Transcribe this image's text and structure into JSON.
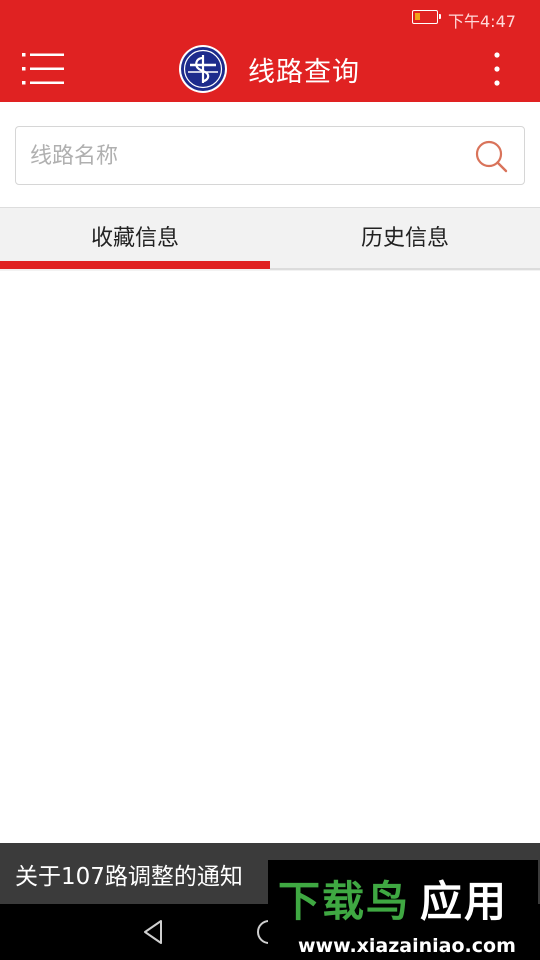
{
  "status_bar": {
    "time": "下午4:47",
    "battery_icon": "battery-low-icon"
  },
  "app_bar": {
    "title": "线路查询",
    "menu_icon": "menu-list-icon",
    "logo_icon": "transit-logo-icon",
    "more_icon": "more-vertical-icon",
    "color": "#e02222"
  },
  "search": {
    "placeholder": "线路名称",
    "value": "",
    "icon": "search-icon",
    "icon_color": "#d9735a"
  },
  "tabs": [
    {
      "label": "收藏信息",
      "selected": true
    },
    {
      "label": "历史信息",
      "selected": false
    }
  ],
  "notice": {
    "text": "关于107路调整的通知"
  },
  "nav_bar": {
    "back_icon": "back-triangle-icon",
    "home_icon": "home-circle-icon"
  },
  "watermark": {
    "title": "下载鸟应用",
    "url": "www.xiazainiao.com"
  }
}
